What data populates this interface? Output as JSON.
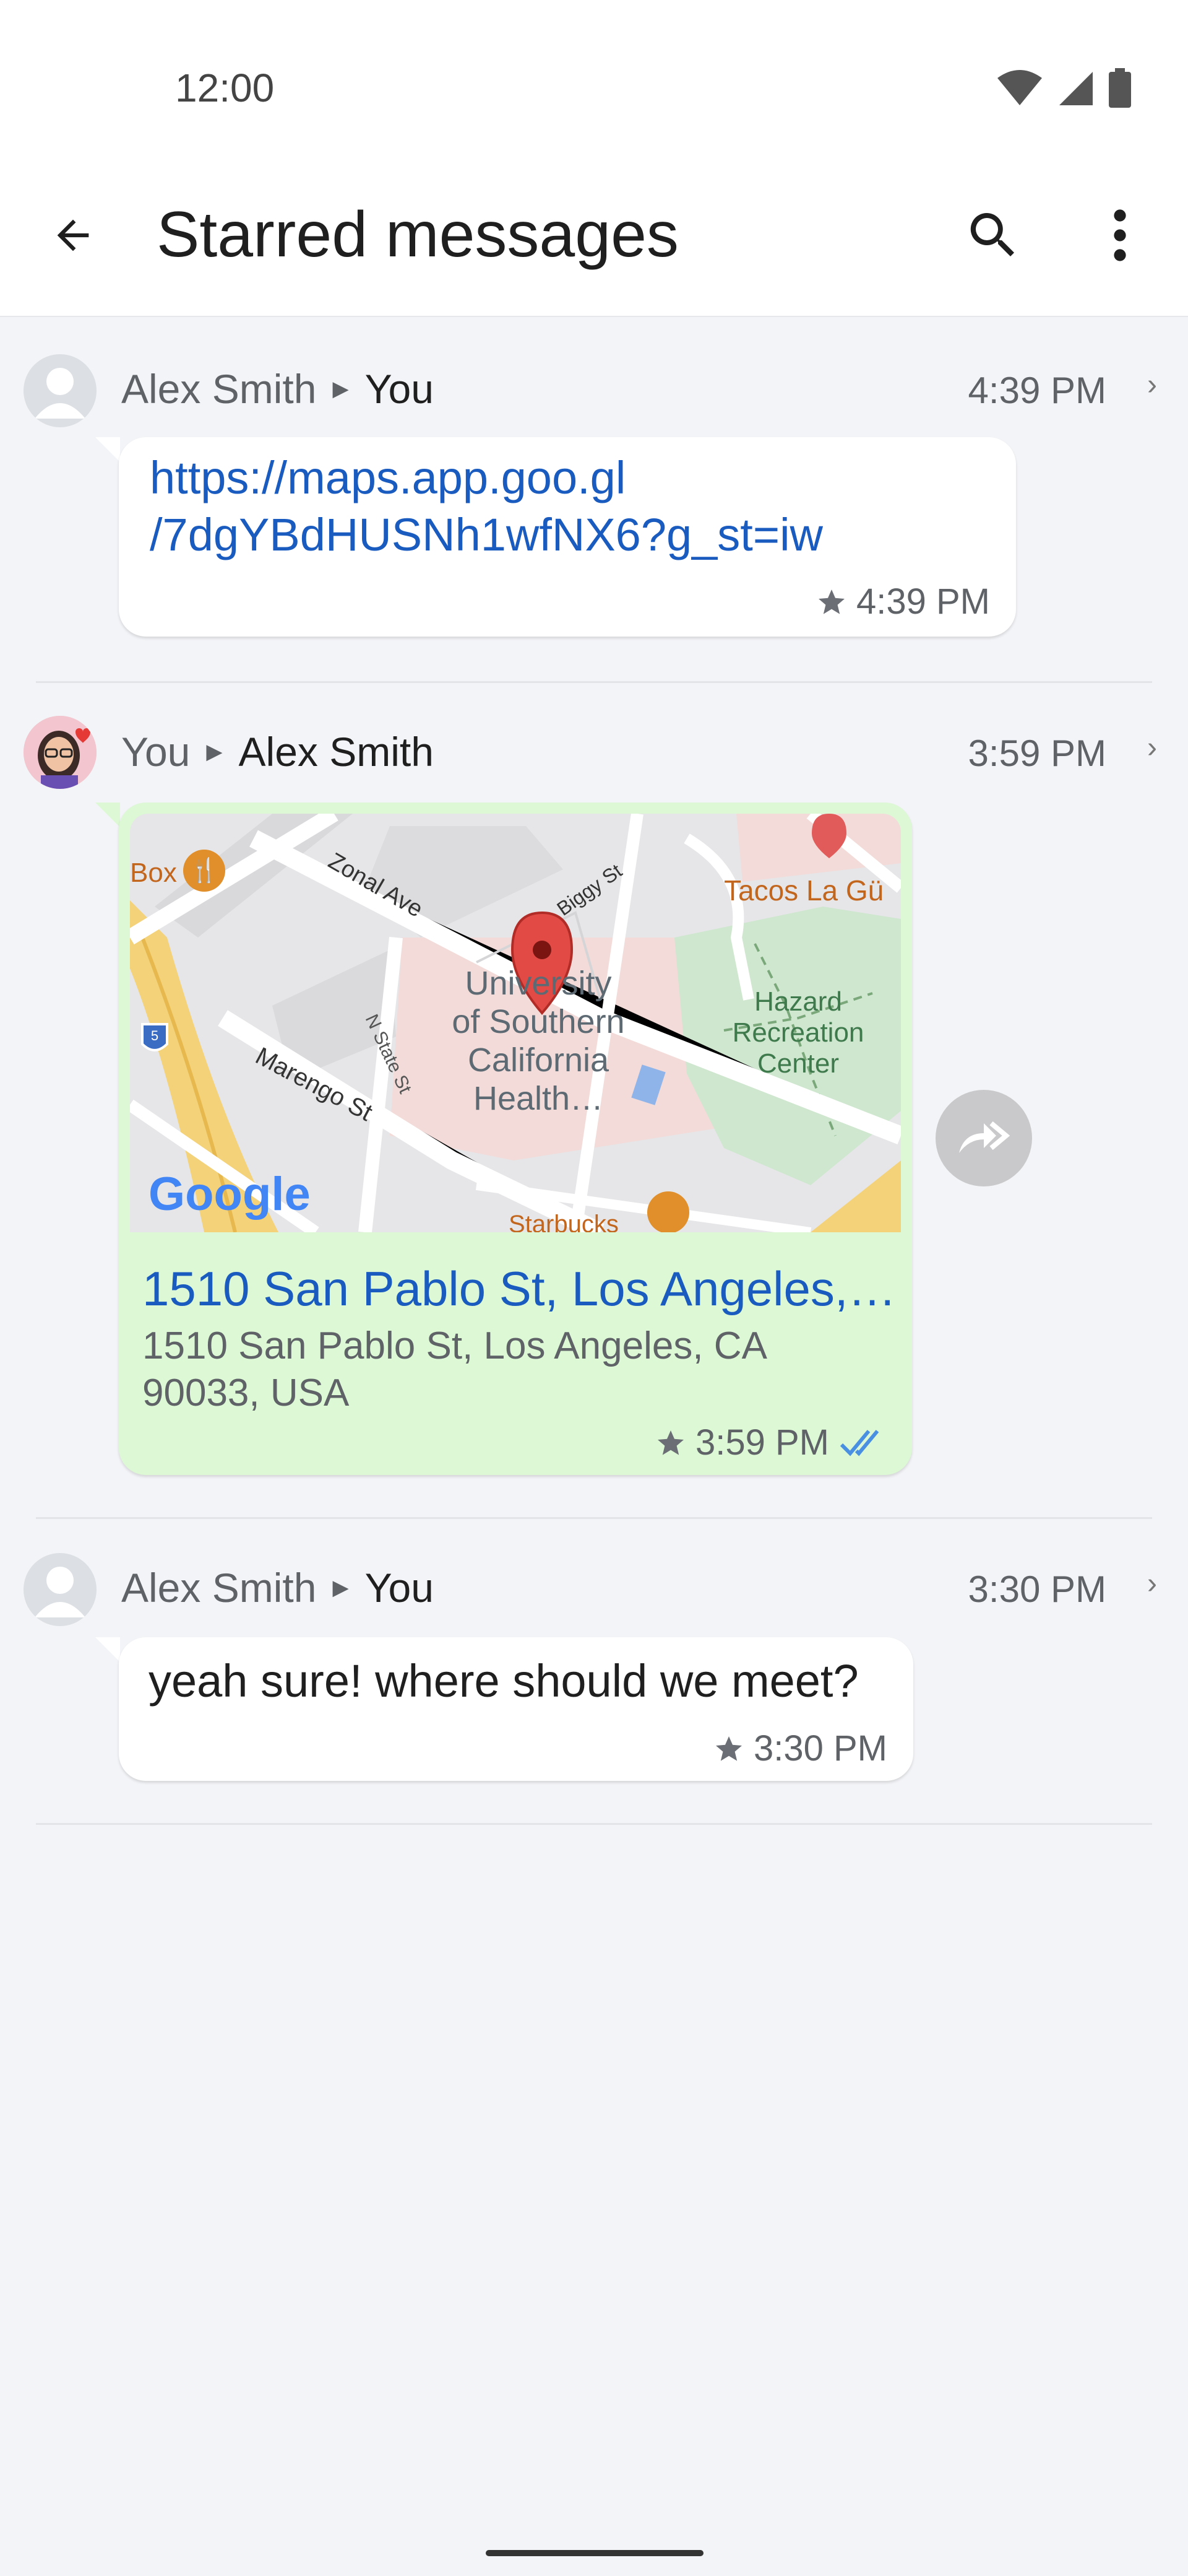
{
  "status_bar": {
    "time": "12:00"
  },
  "app_bar": {
    "title": "Starred messages"
  },
  "messages": [
    {
      "sender": "Alex Smith",
      "recipient": "You",
      "header_time": "4:39 PM",
      "text_line1": "https://maps.app.goo.gl",
      "text_line2": "/7dgYBdHUSNh1wfNX6?g_st=iw",
      "bubble_time": "4:39 PM"
    },
    {
      "sender": "You",
      "recipient": "Alex Smith",
      "header_time": "3:59 PM",
      "location_title": "1510 San Pablo St, Los Angeles,…",
      "location_line1": "1510 San Pablo St, Los Angeles, CA",
      "location_line2": "90033, USA",
      "bubble_time": "3:59 PM",
      "map": {
        "labels": {
          "box": "Box",
          "zonal": "Zonal Ave",
          "biggy": "Biggy St",
          "tacos": "Tacos La Gü",
          "usc1": "University",
          "usc2": "of Southern",
          "usc3": "California",
          "usc4": "Health…",
          "hazard1": "Hazard",
          "hazard2": "Recreation",
          "hazard3": "Center",
          "nstate": "N State St",
          "marengo": "Marengo St",
          "starbucks": "Starbucks",
          "shield": "5",
          "google": "Google"
        }
      }
    },
    {
      "sender": "Alex Smith",
      "recipient": "You",
      "header_time": "3:30 PM",
      "text": "yeah sure! where should we meet?",
      "bubble_time": "3:30 PM"
    }
  ],
  "colors": {
    "link": "#1a5bbf",
    "green_bubble": "#dcf8d4",
    "read_ticks": "#4a90e2"
  }
}
